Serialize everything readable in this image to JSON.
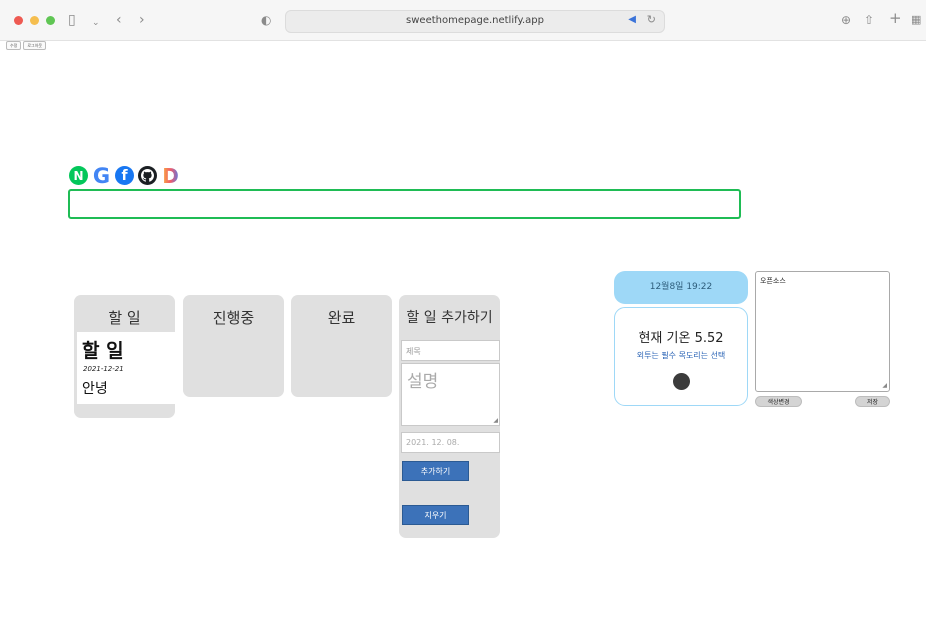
{
  "browser": {
    "url": "sweethomepage.netlify.app",
    "mini_tabs": [
      "수정",
      "로그아웃"
    ]
  },
  "search": {
    "logos": [
      {
        "name": "naver",
        "glyph": "N"
      },
      {
        "name": "google",
        "glyph": "G"
      },
      {
        "name": "facebook",
        "glyph": "f"
      },
      {
        "name": "github",
        "glyph": "○"
      },
      {
        "name": "daum",
        "glyph": "D"
      }
    ],
    "value": ""
  },
  "board": {
    "columns": [
      {
        "title": "할 일"
      },
      {
        "title": "진행중"
      },
      {
        "title": "완료"
      }
    ],
    "todo_card": {
      "title": "할 일",
      "date": "2021-12-21",
      "description": "안녕"
    },
    "add_form": {
      "heading": "할 일 추가하기",
      "title_placeholder": "제목",
      "desc_placeholder": "설명",
      "date_value": "2021. 12. 08.",
      "add_label": "추가하기",
      "clear_label": "지우기"
    }
  },
  "weather": {
    "datetime": "12월8일 19:22",
    "temperature_text": "현재 기온 5.52",
    "advice": "외투는 필수 목도리는 선택"
  },
  "memo": {
    "text": "오픈소스",
    "color_button": "색상변경",
    "save_button": "저장"
  }
}
